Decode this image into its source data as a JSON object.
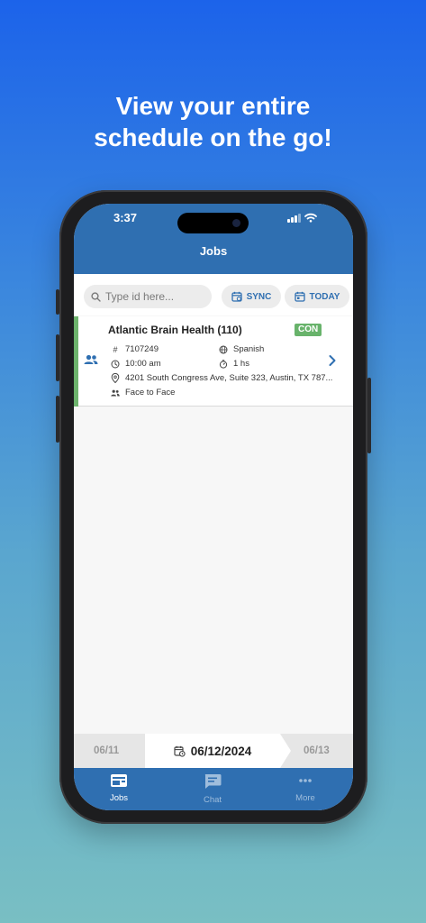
{
  "promo": {
    "line1": "View your entire",
    "line2": "schedule on the go!"
  },
  "status_bar": {
    "time": "3:37"
  },
  "header": {
    "title": "Jobs"
  },
  "search": {
    "placeholder": "Type id here..."
  },
  "actions": {
    "sync_label": "SYNC",
    "today_label": "TODAY"
  },
  "job": {
    "title": "Atlantic Brain Health (110)",
    "status_badge": "CON",
    "id": "7107249",
    "language": "Spanish",
    "time": "10:00 am",
    "duration": "1 hs",
    "address": "4201 South Congress Ave, Suite 323, Austin, TX 787...",
    "mode": "Face to Face"
  },
  "date_nav": {
    "prev": "06/11",
    "current": "06/12/2024",
    "next": "06/13"
  },
  "tabs": [
    {
      "label": "Jobs",
      "icon": "jobs-icon",
      "active": true
    },
    {
      "label": "Chat",
      "icon": "chat-icon",
      "active": false
    },
    {
      "label": "More",
      "icon": "more-icon",
      "active": false
    }
  ],
  "colors": {
    "primary": "#2f6fb1",
    "status_confirmed": "#68b36b",
    "background_top": "#1c63ea",
    "background_bottom": "#79bfc3"
  }
}
